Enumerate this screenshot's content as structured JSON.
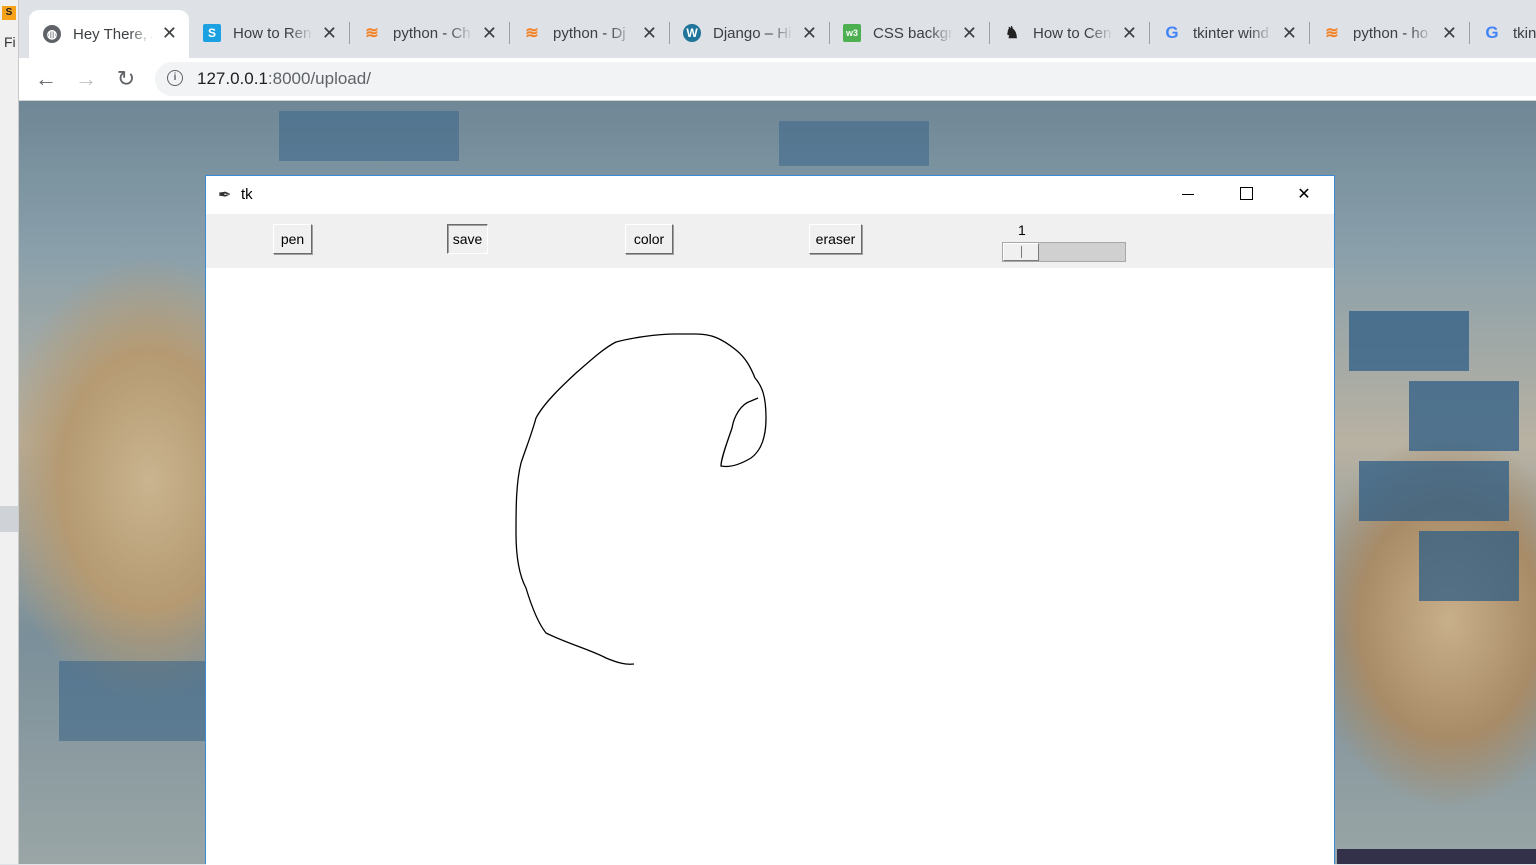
{
  "left_app": {
    "partial_text": "Fi"
  },
  "browser": {
    "tabs": [
      {
        "title": "Hey There, A",
        "favicon": "globe-icon",
        "fav_color": "#5f6368",
        "active": true
      },
      {
        "title": "How to Ren",
        "favicon": "s-logo-icon",
        "fav_color": "#1ba1e2",
        "active": false
      },
      {
        "title": "python - Ch",
        "favicon": "stackoverflow-icon",
        "fav_color": "#f48024",
        "active": false
      },
      {
        "title": "python - Dj",
        "favicon": "stackoverflow-icon",
        "fav_color": "#f48024",
        "active": false
      },
      {
        "title": "Django – Hi",
        "favicon": "wordpress-icon",
        "fav_color": "#21759b",
        "active": false
      },
      {
        "title": "CSS backgr",
        "favicon": "w3schools-icon",
        "fav_color": "#4caf50",
        "active": false
      },
      {
        "title": "How to Cen",
        "favicon": "dev-logo-icon",
        "fav_color": "#222222",
        "active": false
      },
      {
        "title": "tkinter wind",
        "favicon": "google-icon",
        "fav_color": "#4285f4",
        "active": false
      },
      {
        "title": "python - ho",
        "favicon": "stackoverflow-icon",
        "fav_color": "#f48024",
        "active": false
      },
      {
        "title": "tkint",
        "favicon": "google-icon",
        "fav_color": "#4285f4",
        "active": false
      }
    ],
    "url_host": "127.0.0.1",
    "url_rest": ":8000/upload/"
  },
  "tk_window": {
    "title": "tk",
    "buttons": {
      "pen": "pen",
      "save": "save",
      "color": "color",
      "eraser": "eraser"
    },
    "scale_value": "1",
    "scale_fraction": 0.0
  }
}
